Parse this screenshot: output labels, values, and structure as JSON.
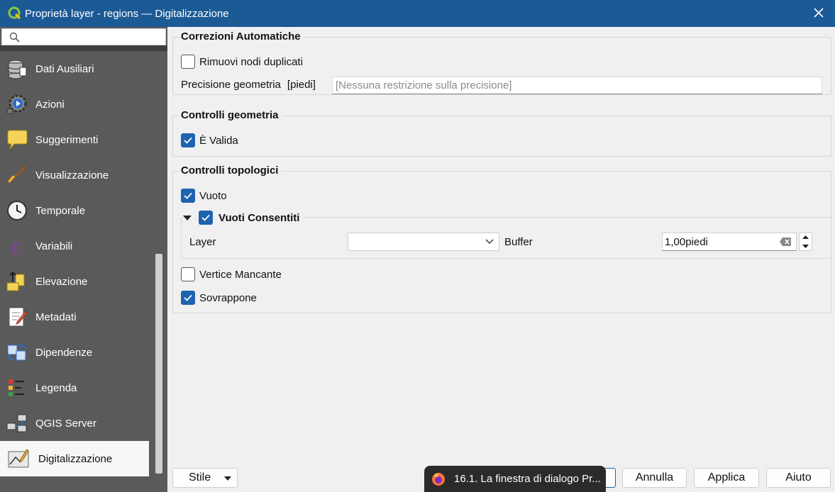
{
  "window": {
    "title": "Proprietà layer - regions — Digitalizzazione"
  },
  "sidebar": {
    "search_placeholder": "",
    "items": [
      {
        "label": "Dati Ausiliari",
        "icon": "database-icon"
      },
      {
        "label": "Azioni",
        "icon": "gear-play-icon"
      },
      {
        "label": "Suggerimenti",
        "icon": "speech-bubble-icon"
      },
      {
        "label": "Visualizzazione",
        "icon": "brush-icon"
      },
      {
        "label": "Temporale",
        "icon": "clock-icon"
      },
      {
        "label": "Variabili",
        "icon": "epsilon-icon"
      },
      {
        "label": "Elevazione",
        "icon": "elevation-icon"
      },
      {
        "label": "Metadati",
        "icon": "document-pen-icon"
      },
      {
        "label": "Dipendenze",
        "icon": "dependencies-icon"
      },
      {
        "label": "Legenda",
        "icon": "legend-icon"
      },
      {
        "label": "QGIS Server",
        "icon": "server-icon"
      },
      {
        "label": "Digitalizzazione",
        "icon": "digitizing-icon",
        "active": true
      }
    ]
  },
  "auto_corrections": {
    "title": "Correzioni Automatiche",
    "remove_duplicates": {
      "label": "Rimuovi nodi duplicati",
      "checked": false
    },
    "precision_label": "Precisione geometria",
    "precision_unit": "[piedi]",
    "precision_placeholder": "[Nessuna restrizione sulla precisione]"
  },
  "geometry_checks": {
    "title": "Controlli geometria",
    "is_valid": {
      "label": "È Valida",
      "checked": true
    }
  },
  "topology_checks": {
    "title": "Controlli topologici",
    "gap": {
      "label": "Vuoto",
      "checked": true
    },
    "allowed_gaps": {
      "label": "Vuoti Consentiti",
      "checked": true
    },
    "layer_label": "Layer",
    "layer_value": "",
    "buffer_label": "Buffer",
    "buffer_value": "1,00piedi",
    "missing_vertex": {
      "label": "Vertice Mancante",
      "checked": false
    },
    "overlaps": {
      "label": "Sovrappone",
      "checked": true
    }
  },
  "buttons": {
    "style": "Stile",
    "cancel": "Annulla",
    "apply": "Applica",
    "help": "Aiuto"
  },
  "taskbar_preview": {
    "text": "16.1. La finestra di dialogo Pr..."
  },
  "colors": {
    "titlebar": "#1c5a96",
    "accent": "#1e63b0",
    "sidebar": "#5a5a5a"
  }
}
